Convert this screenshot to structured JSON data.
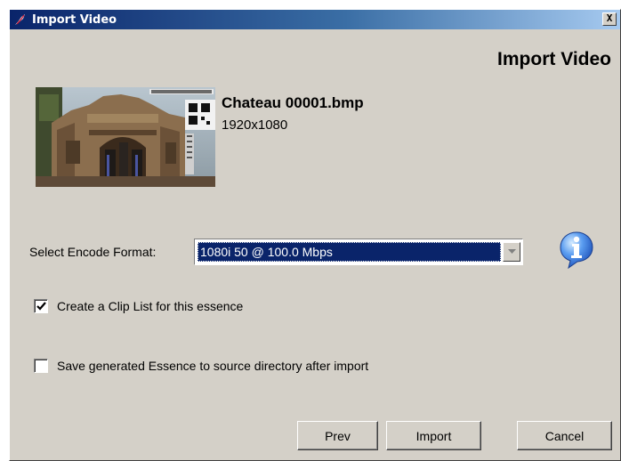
{
  "window": {
    "title": "Import Video",
    "close_label": "X"
  },
  "heading": "Import Video",
  "file": {
    "name": "Chateau 00001.bmp",
    "resolution": "1920x1080"
  },
  "encode": {
    "label": "Select Encode Format:",
    "selected": "1080i 50 @ 100.0 Mbps"
  },
  "options": [
    {
      "label": "Create a Clip List for this essence",
      "checked": true
    },
    {
      "label": "Save generated Essence to source directory after import",
      "checked": false
    }
  ],
  "buttons": {
    "prev": "Prev",
    "import": "Import",
    "cancel": "Cancel"
  },
  "colors": {
    "titlebar_start": "#0a246a",
    "titlebar_end": "#a6caf0",
    "dialog_bg": "#d4d0c8",
    "selection": "#0a246a",
    "info_icon": "#2f6fd6"
  },
  "icons": {
    "title": "app-icon",
    "close": "close-icon",
    "info": "info-icon",
    "dropdown": "chevron-down-icon",
    "check": "checkmark-icon"
  }
}
